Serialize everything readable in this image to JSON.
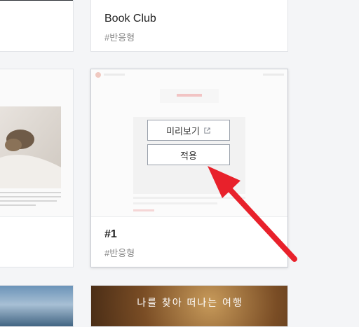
{
  "cards": [
    {
      "title": "Book Club",
      "tag": "#반응형"
    },
    {
      "title": "#1",
      "tag": "#반응형"
    }
  ],
  "overlay": {
    "preview_label": "미리보기",
    "apply_label": "적용"
  },
  "thumbnail_text": {
    "bottom_right_banner": "나를 찾아 떠나는 여행"
  },
  "icons": {
    "preview": "external-link-icon"
  },
  "colors": {
    "arrow": "#e8212b",
    "border": "#e2e4e8",
    "button_border": "#9aa1ab"
  }
}
